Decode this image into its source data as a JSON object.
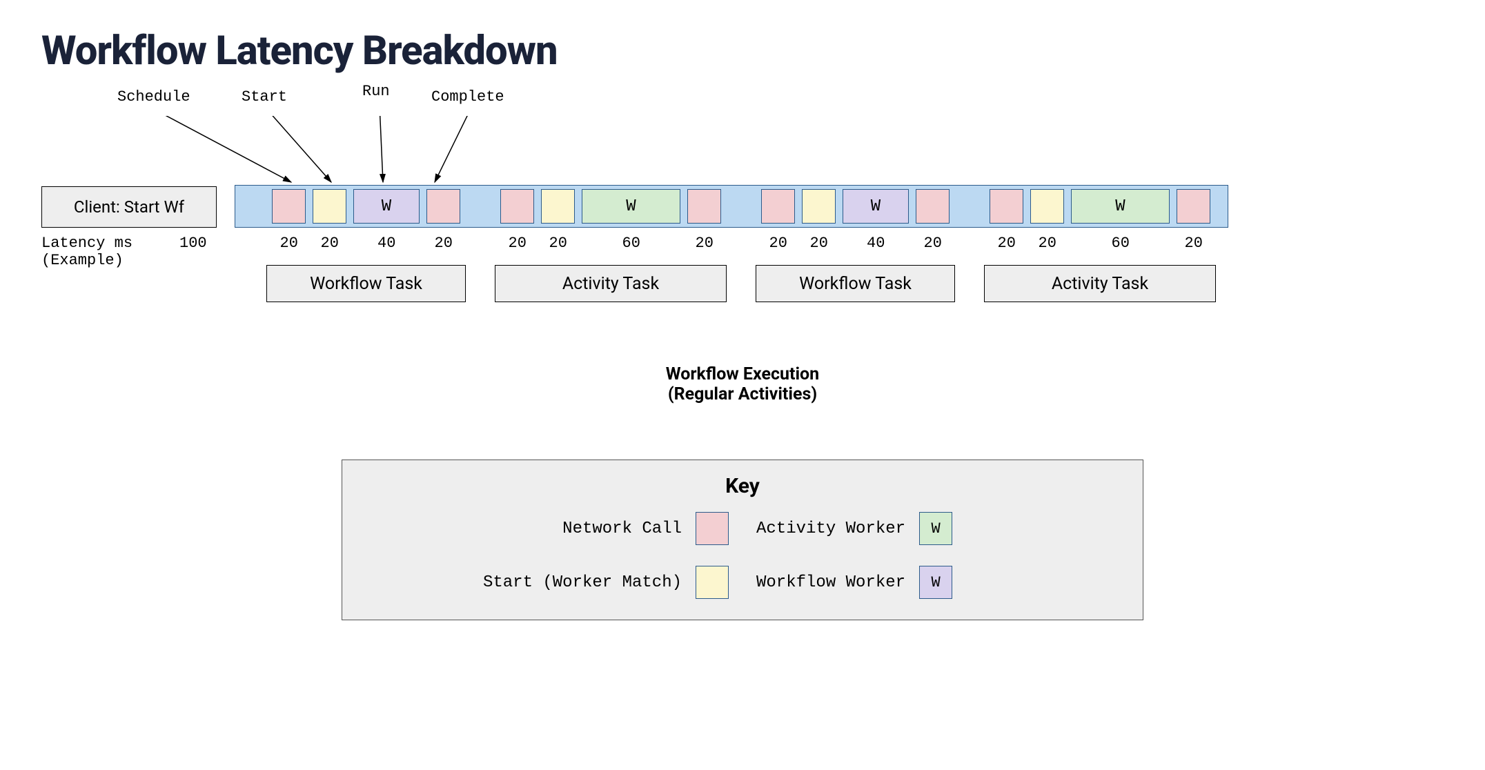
{
  "title": "Workflow Latency Breakdown",
  "annotations": {
    "schedule": "Schedule",
    "start": "Start",
    "run": "Run",
    "complete": "Complete"
  },
  "client_box": "Client: Start Wf",
  "latency_label_line1": "Latency ms",
  "latency_label_line2": "(Example)",
  "client_latency": "100",
  "groups": [
    {
      "label": "Workflow Task",
      "worker_kind": "workflow",
      "segments": [
        {
          "type": "network",
          "latency": "20"
        },
        {
          "type": "match",
          "latency": "20"
        },
        {
          "type": "worker",
          "latency": "40",
          "letter": "W"
        },
        {
          "type": "network",
          "latency": "20"
        }
      ]
    },
    {
      "label": "Activity Task",
      "worker_kind": "activity",
      "segments": [
        {
          "type": "network",
          "latency": "20"
        },
        {
          "type": "match",
          "latency": "20"
        },
        {
          "type": "worker",
          "latency": "60",
          "letter": "W"
        },
        {
          "type": "network",
          "latency": "20"
        }
      ]
    },
    {
      "label": "Workflow Task",
      "worker_kind": "workflow",
      "segments": [
        {
          "type": "network",
          "latency": "20"
        },
        {
          "type": "match",
          "latency": "20"
        },
        {
          "type": "worker",
          "latency": "40",
          "letter": "W"
        },
        {
          "type": "network",
          "latency": "20"
        }
      ]
    },
    {
      "label": "Activity Task",
      "worker_kind": "activity",
      "segments": [
        {
          "type": "network",
          "latency": "20"
        },
        {
          "type": "match",
          "latency": "20"
        },
        {
          "type": "worker",
          "latency": "60",
          "letter": "W"
        },
        {
          "type": "network",
          "latency": "20"
        }
      ]
    }
  ],
  "caption_line1": "Workflow Execution",
  "caption_line2": "(Regular Activities)",
  "legend": {
    "title": "Key",
    "network": "Network Call",
    "activity_worker": "Activity Worker",
    "match": "Start (Worker Match)",
    "workflow_worker": "Workflow Worker",
    "w": "W"
  }
}
